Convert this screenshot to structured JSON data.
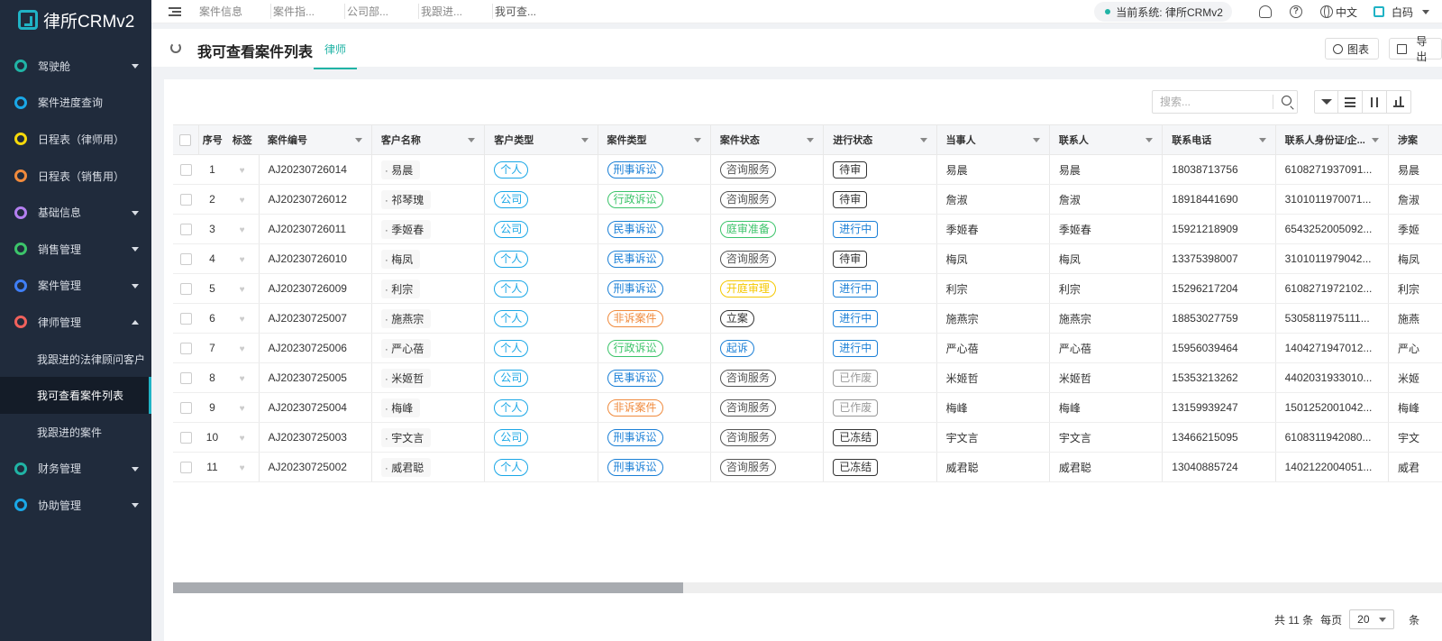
{
  "app": {
    "name": "律所CRMv2"
  },
  "sidebar": {
    "items": [
      {
        "label": "驾驶舱",
        "icon": "cockpit-icon",
        "color": "#20b3a5",
        "arrow": "down"
      },
      {
        "label": "案件进度查询",
        "icon": "progress-icon",
        "color": "#1aa7e6",
        "arrow": ""
      },
      {
        "label": "日程表（律师用）",
        "icon": "calendar-icon",
        "color": "#f5d90a",
        "arrow": ""
      },
      {
        "label": "日程表（销售用）",
        "icon": "calendar-icon",
        "color": "#f08a3c",
        "arrow": ""
      },
      {
        "label": "基础信息",
        "icon": "info-icon",
        "color": "#b47ff0",
        "arrow": "down"
      },
      {
        "label": "销售管理",
        "icon": "sales-icon",
        "color": "#3cc46a",
        "arrow": "down"
      },
      {
        "label": "案件管理",
        "icon": "case-icon",
        "color": "#3f7ef5",
        "arrow": "down"
      },
      {
        "label": "律师管理",
        "icon": "lawyer-icon",
        "color": "#f0615c",
        "arrow": "up"
      }
    ],
    "sub_items": [
      {
        "label": "我跟进的法律顾问客户",
        "active": false
      },
      {
        "label": "我可查看案件列表",
        "active": true
      },
      {
        "label": "我跟进的案件",
        "active": false
      }
    ],
    "bottom_items": [
      {
        "label": "财务管理",
        "icon": "finance-icon",
        "color": "#20b3a5",
        "arrow": "down"
      },
      {
        "label": "协助管理",
        "icon": "assist-icon",
        "color": "#1aa7e6",
        "arrow": "down"
      }
    ]
  },
  "topbar": {
    "tabs": [
      "案件信息",
      "案件指...",
      "公司部...",
      "我跟进...",
      "我可查..."
    ],
    "current_system_label": "当前系统: 律所CRMv2",
    "language": "中文",
    "user_name": "白码"
  },
  "page": {
    "title": "我可查看案件列表",
    "sub_tab": "律师",
    "chart_button": "图表",
    "export_button": "导出",
    "search_placeholder": "搜索..."
  },
  "table": {
    "columns": [
      "序号",
      "标签",
      "案件编号",
      "客户名称",
      "客户类型",
      "案件类型",
      "案件状态",
      "进行状态",
      "当事人",
      "联系人",
      "联系电话",
      "联系人身份证/企...",
      "涉案"
    ],
    "rows": [
      [
        "1",
        "AJ20230726014",
        "易晨",
        "个人",
        "刑事诉讼",
        "咨询服务",
        "待审",
        "易晨",
        "易晨",
        "18038713756",
        "6108271937091...",
        "易晨"
      ],
      [
        "2",
        "AJ20230726012",
        "祁琴瑰",
        "公司",
        "行政诉讼",
        "咨询服务",
        "待审",
        "詹淑",
        "詹淑",
        "18918441690",
        "3101011970071...",
        "詹淑"
      ],
      [
        "3",
        "AJ20230726011",
        "季姬春",
        "公司",
        "民事诉讼",
        "庭审准备",
        "进行中",
        "季姬春",
        "季姬春",
        "15921218909",
        "6543252005092...",
        "季姬"
      ],
      [
        "4",
        "AJ20230726010",
        "梅凤",
        "个人",
        "民事诉讼",
        "咨询服务",
        "待审",
        "梅凤",
        "梅凤",
        "13375398007",
        "3101011979042...",
        "梅凤"
      ],
      [
        "5",
        "AJ20230726009",
        "利宗",
        "个人",
        "刑事诉讼",
        "开庭审理",
        "进行中",
        "利宗",
        "利宗",
        "15296217204",
        "6108271972102...",
        "利宗"
      ],
      [
        "6",
        "AJ20230725007",
        "施燕宗",
        "个人",
        "非诉案件",
        "立案",
        "进行中",
        "施燕宗",
        "施燕宗",
        "18853027759",
        "5305811975111...",
        "施燕"
      ],
      [
        "7",
        "AJ20230725006",
        "严心蓓",
        "个人",
        "行政诉讼",
        "起诉",
        "进行中",
        "严心蓓",
        "严心蓓",
        "15956039464",
        "1404271947012...",
        "严心"
      ],
      [
        "8",
        "AJ20230725005",
        "米姬哲",
        "公司",
        "民事诉讼",
        "咨询服务",
        "已作废",
        "米姬哲",
        "米姬哲",
        "15353213262",
        "4402031933010...",
        "米姬"
      ],
      [
        "9",
        "AJ20230725004",
        "梅峰",
        "个人",
        "非诉案件",
        "咨询服务",
        "已作废",
        "梅峰",
        "梅峰",
        "13159939247",
        "1501252001042...",
        "梅峰"
      ],
      [
        "10",
        "AJ20230725003",
        "宇文言",
        "公司",
        "刑事诉讼",
        "咨询服务",
        "已冻结",
        "宇文言",
        "宇文言",
        "13466215095",
        "6108311942080...",
        "宇文"
      ],
      [
        "11",
        "AJ20230725002",
        "威君聪",
        "个人",
        "刑事诉讼",
        "咨询服务",
        "已冻结",
        "威君聪",
        "威君聪",
        "13040885724",
        "1402122004051...",
        "威君"
      ]
    ]
  },
  "tag_colors": {
    "个人": "#1aa7e6",
    "公司": "#1aa7e6",
    "刑事诉讼": "#1a7fd6",
    "行政诉讼": "#3cc46a",
    "民事诉讼": "#1a7fd6",
    "非诉案件": "#f08a3c",
    "咨询服务": "#555555",
    "庭审准备": "#3cc46a",
    "开庭审理": "#f5c800",
    "立案": "#333333",
    "起诉": "#1a7fd6",
    "待审": "#333333",
    "进行中": "#1a7fd6",
    "已作废": "#999999",
    "已冻结": "#333333"
  },
  "pagination": {
    "total": "共 11 条",
    "per_page_label": "每页",
    "page_size": "20",
    "unit": "条"
  }
}
